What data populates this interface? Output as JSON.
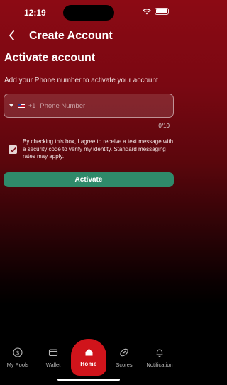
{
  "status_bar": {
    "time": "12:19"
  },
  "header": {
    "title": "Create Account"
  },
  "form": {
    "heading": "Activate account",
    "subtitle": "Add your Phone number to activate your account",
    "country_code": "+1",
    "phone_placeholder": "Phone Number",
    "char_counter": "0/10",
    "consent_text": "By checking this box, I agree to receive a text message with a security code to verify my identity. Standard messaging rates may apply.",
    "consent_checked": true,
    "activate_label": "Activate"
  },
  "tab_bar": {
    "items": [
      {
        "label": "My Pools",
        "icon": "dollar-circle-icon"
      },
      {
        "label": "Wallet",
        "icon": "wallet-icon"
      },
      {
        "label": "Home",
        "icon": "home-icon",
        "active": true
      },
      {
        "label": "Scores",
        "icon": "football-icon"
      },
      {
        "label": "Notification",
        "icon": "bell-icon"
      }
    ]
  },
  "colors": {
    "accent_green": "#2f8a6a",
    "home_red": "#d0141b",
    "background_top": "#8c0a14"
  }
}
